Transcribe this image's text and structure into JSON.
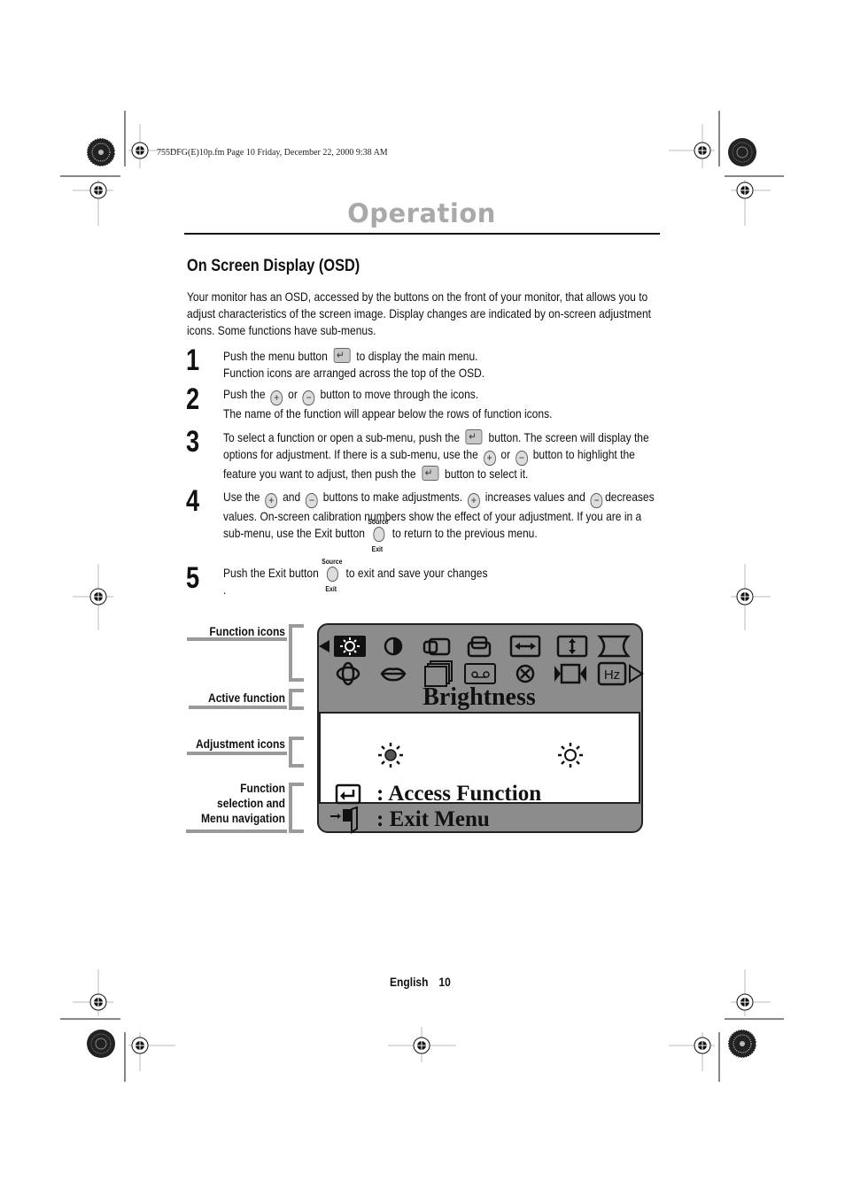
{
  "header_meta": "755DFG(E)10p.fm  Page 10  Friday, December 22, 2000  9:38 AM",
  "page_title": "Operation",
  "section": {
    "title": "On Screen Display (OSD)",
    "intro": "Your monitor has an OSD, accessed by the buttons on the front of your monitor, that allows you to adjust characteristics of the screen image. Display changes are indicated by on-screen adjustment icons. Some functions have sub-menus."
  },
  "steps": [
    {
      "num": "1",
      "parts": [
        "Push the menu button",
        "to display the main menu.",
        "Function icons are arranged across the top of the OSD."
      ]
    },
    {
      "num": "2",
      "parts": [
        "Push the",
        "or",
        "button to move through the icons.",
        "The name of the function will appear below the rows of function icons."
      ]
    },
    {
      "num": "3",
      "parts": [
        "To select a function or open a sub-menu, push the",
        "button. The screen will display the options for adjustment. If there is a sub-menu, use the",
        "or",
        "button to highlight the feature you want to adjust, then push the",
        "button to select it."
      ]
    },
    {
      "num": "4",
      "parts": [
        "Use the",
        "and",
        "buttons to make adjustments.",
        "increases values and",
        "decreases values. On-screen calibration numbers show the effect of your adjustment. If you are in a sub-menu, use the Exit button",
        "to return to the previous menu."
      ]
    },
    {
      "num": "5",
      "parts": [
        "Push the Exit button",
        "to exit and save your changes",
        "."
      ]
    }
  ],
  "buttons": {
    "plus_glyph": "+",
    "minus_glyph": "−",
    "exit_top_label": "Source",
    "exit_bottom_label": "Exit"
  },
  "callouts": {
    "function_icons": "Function icons",
    "active_function": "Active function",
    "adjustment_icons": "Adjustment icons",
    "nav_line1": "Function",
    "nav_line2": "selection and",
    "nav_line3": "Menu navigation"
  },
  "osd": {
    "function_icons_row1": [
      "brightness-icon",
      "contrast-icon",
      "h-position-icon",
      "v-position-icon",
      "h-size-icon",
      "v-size-icon",
      "pincushion-icon"
    ],
    "function_icons_row2": [
      "rotation-icon",
      "trapezoid-icon",
      "recall-icon",
      "degauss-icon",
      "moire-icon",
      "side-pincushion-icon",
      "display-mode-icon"
    ],
    "selected_function": "brightness-icon",
    "active_function_name": "Brightness",
    "access_label": ": Access Function",
    "exit_label": ": Exit Menu",
    "colors": {
      "panel": "#8c8c8c",
      "inner": "#ffffff",
      "selected_bg": "#111111"
    }
  },
  "footer": {
    "language": "English",
    "page_number": "10"
  }
}
